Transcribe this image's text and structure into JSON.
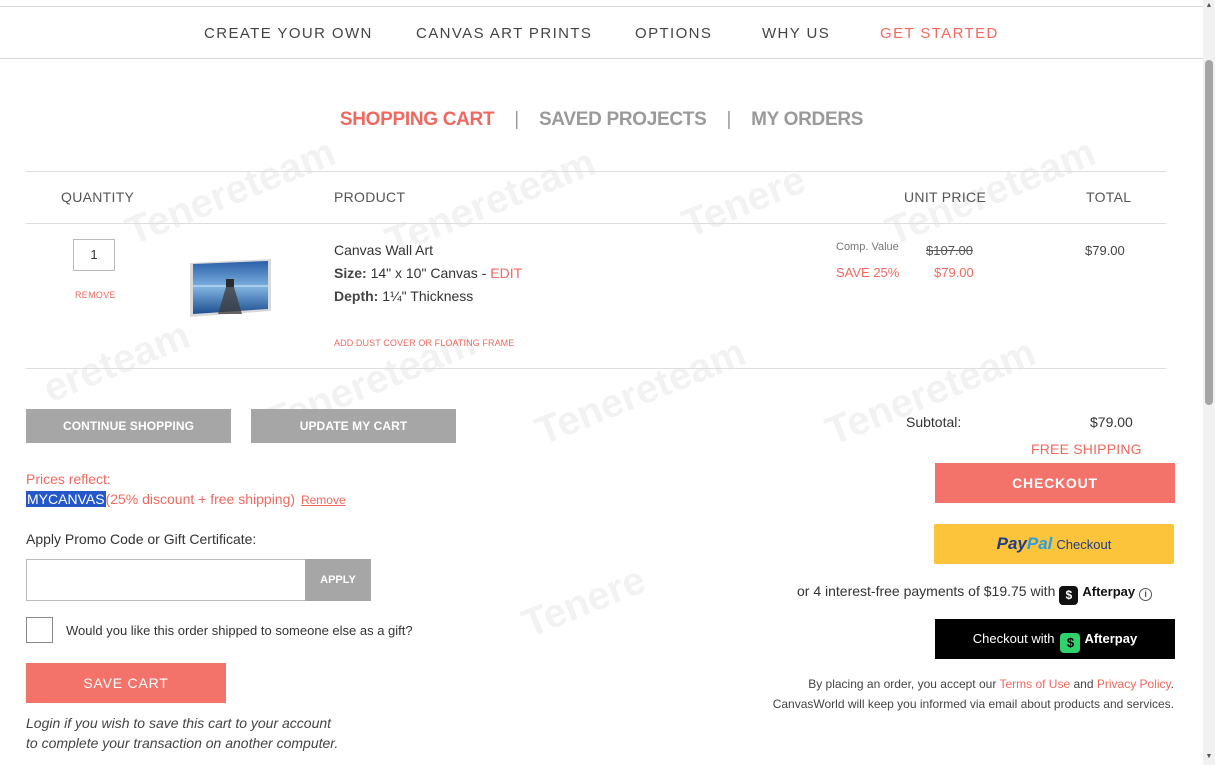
{
  "nav": {
    "items": [
      "CREATE YOUR OWN",
      "CANVAS ART PRINTS",
      "OPTIONS",
      "WHY US"
    ],
    "cta": "GET STARTED"
  },
  "tabs": {
    "cart": "SHOPPING CART",
    "saved": "SAVED PROJECTS",
    "orders": "MY ORDERS",
    "separator": "|"
  },
  "table": {
    "headers": {
      "quantity": "QUANTITY",
      "product": "PRODUCT",
      "unit_price": "UNIT PRICE",
      "total": "TOTAL"
    }
  },
  "item": {
    "quantity": "1",
    "remove": "REMOVE",
    "name": "Canvas Wall Art",
    "size_label": "Size:",
    "size_value": "14\" x 10\" Canvas -",
    "edit": "EDIT",
    "depth_label": "Depth:",
    "depth_value": "1¼\" Thickness",
    "add_dust": "ADD DUST COVER OR FLOATING FRAME",
    "comp_label": "Comp. Value",
    "comp_price": "$107.00",
    "save_label": "SAVE 25%",
    "sale_price": "$79.00",
    "total": "$79.00"
  },
  "buttons": {
    "continue": "CONTINUE SHOPPING",
    "update": "UPDATE MY CART",
    "apply": "APPLY",
    "save_cart": "SAVE CART",
    "checkout": "CHECKOUT"
  },
  "promo": {
    "prices_reflect": "Prices reflect:",
    "code": "MYCANVAS",
    "details": "(25% discount + free shipping)",
    "remove": "Remove",
    "apply_label": "Apply Promo Code or Gift Certificate:",
    "input_value": ""
  },
  "gift": {
    "label": "Would you like this order shipped to someone else as a gift?"
  },
  "login_note": {
    "line1": "Login if you wish to save this cart to your account",
    "line2": "to complete your transaction on another computer."
  },
  "summary": {
    "subtotal_label": "Subtotal:",
    "subtotal_value": "$79.00",
    "free_shipping": "FREE SHIPPING"
  },
  "paypal": {
    "pay": "Pay",
    "pal": "Pal",
    "text": "Checkout"
  },
  "afterpay": {
    "info": "or 4 interest-free payments of $19.75 with",
    "brand": "Afterpay",
    "button_text": "Checkout with",
    "button_brand": "Afterpay"
  },
  "legal": {
    "line1_pre": "By placing an order, you accept our",
    "terms": "Terms of Use",
    "and": "and",
    "privacy": "Privacy Policy",
    "period": ".",
    "line2": "CanvasWorld will keep you informed via email about products and services."
  },
  "colors": {
    "accent": "#f0685f",
    "gray_button": "#a6a6a6",
    "paypal_yellow": "#fcc43a",
    "afterpay_green": "#2fd26b"
  }
}
